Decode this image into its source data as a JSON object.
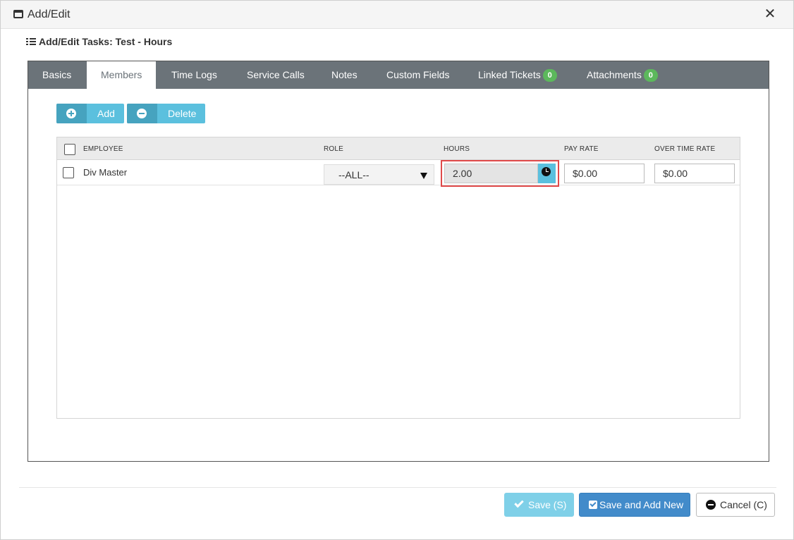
{
  "window": {
    "title": "Add/Edit",
    "close_glyph": "✕"
  },
  "heading": {
    "text": "Add/Edit Tasks: Test - Hours"
  },
  "tabs": [
    {
      "label": "Basics"
    },
    {
      "label": "Members"
    },
    {
      "label": "Time Logs"
    },
    {
      "label": "Service Calls"
    },
    {
      "label": "Notes"
    },
    {
      "label": "Custom Fields"
    },
    {
      "label": "Linked Tickets",
      "badge": "0"
    },
    {
      "label": "Attachments",
      "badge": "0"
    }
  ],
  "active_tab": "Members",
  "toolbar": {
    "add_label": "Add",
    "delete_label": "Delete"
  },
  "grid": {
    "columns": [
      "EMPLOYEE",
      "ROLE",
      "HOURS",
      "PAY RATE",
      "OVER TIME RATE"
    ],
    "rows": [
      {
        "employee": "Div Master",
        "role": "--ALL--",
        "hours": "2.00",
        "pay_rate": "$0.00",
        "overtime_rate": "$0.00"
      }
    ]
  },
  "footer": {
    "save_label": "Save (S)",
    "save_new_label": "Save and Add New",
    "cancel_label": "Cancel (C)"
  },
  "colors": {
    "tabbar": "#6b7379",
    "accent": "#5bc0de",
    "primary": "#428bca",
    "badge": "#5cb85c",
    "highlight": "#e04a4a"
  }
}
